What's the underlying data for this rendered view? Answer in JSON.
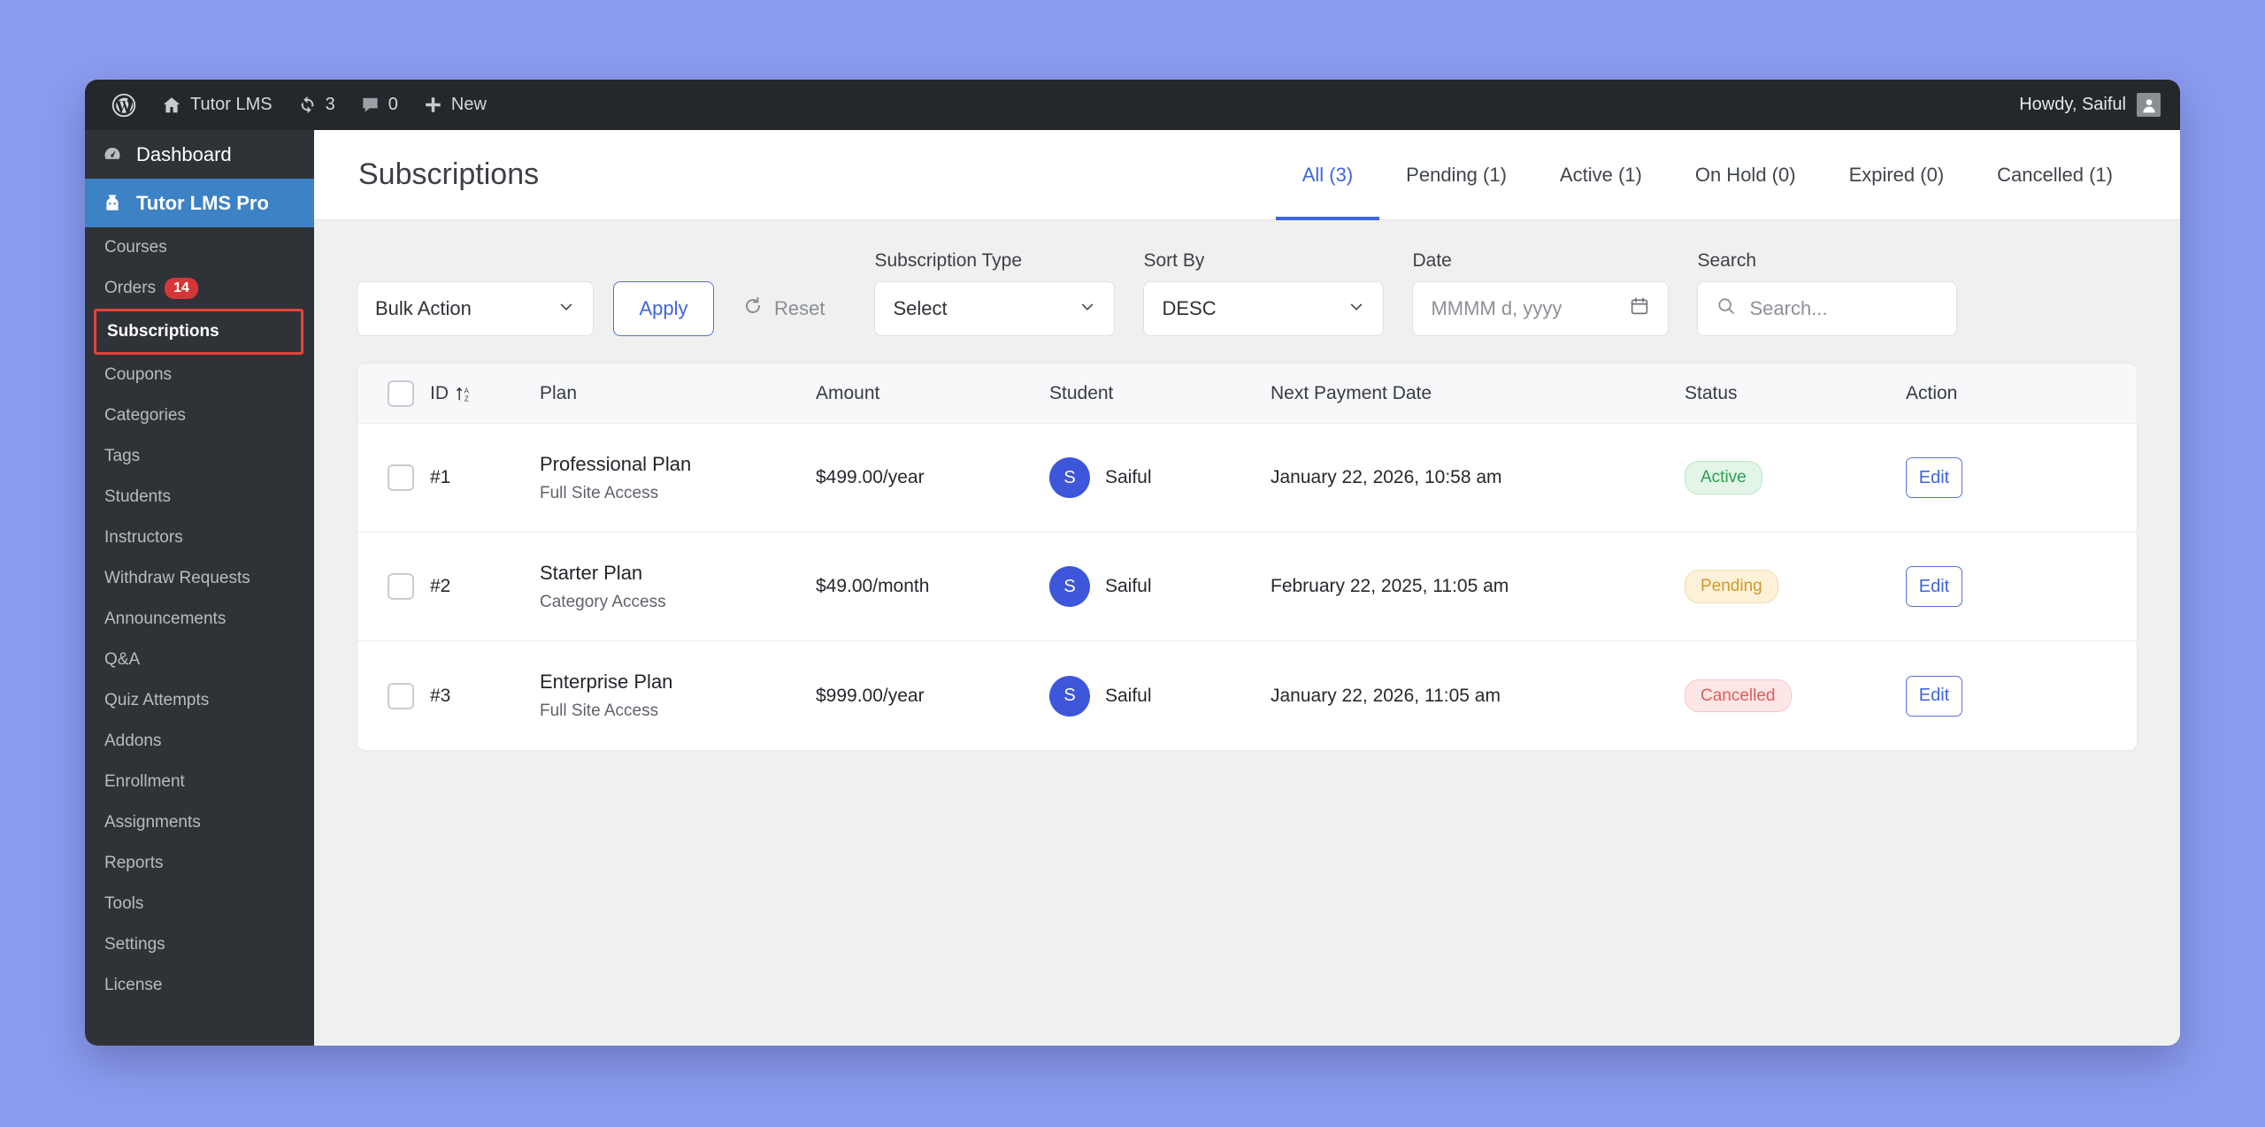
{
  "adminbar": {
    "wp_logo_icon": "wordpress-icon",
    "site_home_icon": "home-icon",
    "site_name": "Tutor LMS",
    "updates_icon": "updates-icon",
    "updates_count": "3",
    "comments_icon": "comment-icon",
    "comments_count": "0",
    "new_icon": "plus-icon",
    "new_label": "New",
    "howdy": "Howdy, Saiful",
    "avatar_icon": "user-avatar-icon"
  },
  "sidebar": {
    "top_items": [
      {
        "label": "Dashboard",
        "icon": "dashboard-icon",
        "active": false
      },
      {
        "label": "Tutor LMS Pro",
        "icon": "tutor-lms-icon",
        "active": true
      }
    ],
    "sub_items": [
      {
        "label": "Courses"
      },
      {
        "label": "Orders",
        "badge": "14"
      },
      {
        "label": "Subscriptions",
        "current": true
      },
      {
        "label": "Coupons"
      },
      {
        "label": "Categories"
      },
      {
        "label": "Tags"
      },
      {
        "label": "Students"
      },
      {
        "label": "Instructors"
      },
      {
        "label": "Withdraw Requests"
      },
      {
        "label": "Announcements"
      },
      {
        "label": "Q&A"
      },
      {
        "label": "Quiz Attempts"
      },
      {
        "label": "Addons"
      },
      {
        "label": "Enrollment"
      },
      {
        "label": "Assignments"
      },
      {
        "label": "Reports"
      },
      {
        "label": "Tools"
      },
      {
        "label": "Settings"
      },
      {
        "label": "License"
      }
    ]
  },
  "header": {
    "title": "Subscriptions",
    "tabs": [
      {
        "label": "All (3)",
        "active": true
      },
      {
        "label": "Pending (1)",
        "active": false
      },
      {
        "label": "Active (1)",
        "active": false
      },
      {
        "label": "On Hold (0)",
        "active": false
      },
      {
        "label": "Expired (0)",
        "active": false
      },
      {
        "label": "Cancelled (1)",
        "active": false
      }
    ]
  },
  "filters": {
    "bulk_action_value": "Bulk Action",
    "apply_label": "Apply",
    "reset_label": "Reset",
    "reset_icon": "refresh-icon",
    "subscription_type_label": "Subscription Type",
    "subscription_type_value": "Select",
    "sort_by_label": "Sort By",
    "sort_by_value": "DESC",
    "date_label": "Date",
    "date_placeholder": "MMMM d, yyyy",
    "date_icon": "calendar-icon",
    "search_label": "Search",
    "search_placeholder": "Search...",
    "search_icon": "search-icon",
    "chevron_icon": "chevron-down-icon"
  },
  "table": {
    "columns": {
      "id": "ID",
      "id_sort_icon": "sort-az-icon",
      "plan": "Plan",
      "amount": "Amount",
      "student": "Student",
      "next_payment_date": "Next Payment Date",
      "status": "Status",
      "action": "Action"
    },
    "rows": [
      {
        "id": "#1",
        "plan": "Professional Plan",
        "plan_sub": "Full Site Access",
        "amount": "$499.00/year",
        "student": "Saiful",
        "student_initial": "S",
        "next_payment_date": "January 22, 2026, 10:58 am",
        "status": "Active",
        "status_kind": "active",
        "action_label": "Edit"
      },
      {
        "id": "#2",
        "plan": "Starter Plan",
        "plan_sub": "Category Access",
        "amount": "$49.00/month",
        "student": "Saiful",
        "student_initial": "S",
        "next_payment_date": "February 22, 2025, 11:05 am",
        "status": "Pending",
        "status_kind": "pending",
        "action_label": "Edit"
      },
      {
        "id": "#3",
        "plan": "Enterprise Plan",
        "plan_sub": "Full Site Access",
        "amount": "$999.00/year",
        "student": "Saiful",
        "student_initial": "S",
        "next_payment_date": "January 22, 2026, 11:05 am",
        "status": "Cancelled",
        "status_kind": "cancelled",
        "action_label": "Edit"
      }
    ]
  },
  "colors": {
    "desktop_bg": "#8b9cf0",
    "accent": "#3e64de",
    "sidebar_bg": "#2f3337",
    "adminbar_bg": "#23282d",
    "highlight_border": "#e8413c",
    "status_active": "#2e9e53",
    "status_pending": "#d09a2a",
    "status_cancelled": "#e05b5b"
  }
}
